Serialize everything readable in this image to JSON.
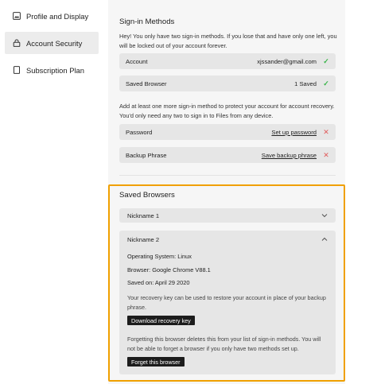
{
  "sidebar": {
    "items": [
      {
        "label": "Profile and Display",
        "icon": "profile-display-icon"
      },
      {
        "label": "Account Security",
        "icon": "lock-icon",
        "active": true
      },
      {
        "label": "Subscription Plan",
        "icon": "document-icon"
      }
    ]
  },
  "signin": {
    "title": "Sign-in Methods",
    "warning": "Hey! You only have two sign-in methods. If you lose that and have only one left, you will be locked out of your account forever.",
    "methods": [
      {
        "label": "Account",
        "value": "xjssander@gmail.com",
        "status": "ok"
      },
      {
        "label": "Saved Browser",
        "value": "1 Saved",
        "status": "ok"
      }
    ],
    "add_hint": "Add at least one more sign-in method to protect your account for account recovery. You'd only need any two to sign in to Files from any device.",
    "missing": [
      {
        "label": "Password",
        "action": "Set up password",
        "status": "missing"
      },
      {
        "label": "Backup Phrase",
        "action": "Save backup phrase",
        "status": "missing"
      }
    ]
  },
  "saved_browsers": {
    "title": "Saved Browsers",
    "collapsed_item": {
      "label": "Nickname 1"
    },
    "expanded_item": {
      "label": "Nickname 2",
      "os": "Operating System: Linux",
      "browser": "Browser: Google Chrome V88.1",
      "saved_on": "Saved on: April 29 2020",
      "recovery_text": "Your recovery key can be used to restore your account in place of your backup phrase.",
      "download_label": "Download recovery key",
      "forget_text": "Forgetting this browser deletes this from your list of sign-in methods. You will not be able to forget a browser if you only have two methods set up.",
      "forget_label": "Forget this browser"
    }
  },
  "colors": {
    "highlight": "#f0a000",
    "ok": "#3ab54a",
    "missing": "#e05a5a",
    "row_bg": "#e6e6e6",
    "button_bg": "#1c1c1c"
  }
}
